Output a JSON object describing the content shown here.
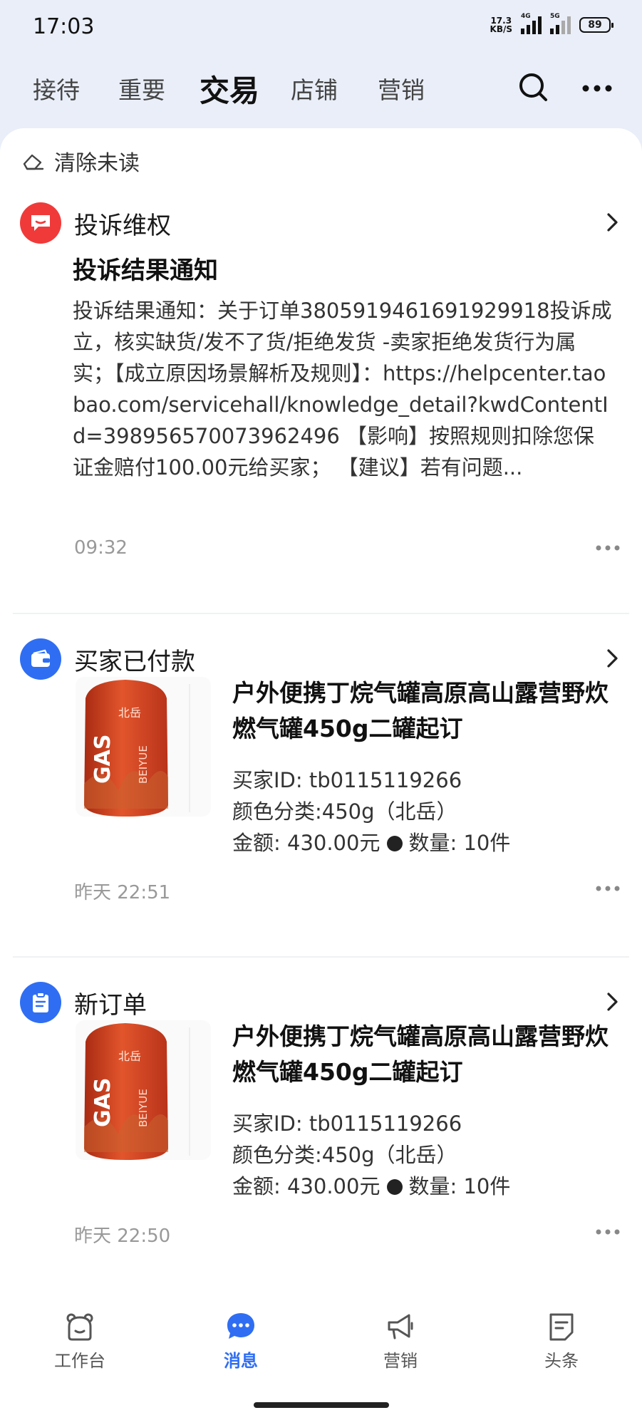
{
  "status_bar": {
    "time": "17:03",
    "net_speed_value": "17.3",
    "net_speed_unit": "KB/S",
    "signal1_label": "4G",
    "signal2_label": "5G",
    "battery": "89"
  },
  "top_tabs": [
    "接待",
    "重要",
    "交易",
    "店铺",
    "营销"
  ],
  "active_tab": "交易",
  "clear_unread_label": "清除未读",
  "cards": [
    {
      "type": "complaint",
      "icon": "complaint-icon",
      "category": "投诉维权",
      "title": "投诉结果通知",
      "body": "投诉结果通知：关于订单3805919461691929918投诉成立，核实缺货/发不了货/拒绝发货 -卖家拒绝发货行为属实；【成立原因场景解析及规则】：https://helpcenter.taobao.com/servicehall/knowledge_detail?kwdContentId=398956570073962496 【影响】按照规则扣除您保证金赔付100.00元给买家； 【建议】若有问题...",
      "time": "09:32"
    },
    {
      "type": "paid",
      "icon": "wallet-icon",
      "category": "买家已付款",
      "product_title": "户外便携丁烷气罐高原高山露营野炊燃气罐450g二罐起订",
      "buyer_id": "买家ID: tb0115119266",
      "variant": "颜色分类:450g（北岳）",
      "amount": "金额: 430.00元",
      "quantity": "数量: 10件",
      "time": "昨天 22:51"
    },
    {
      "type": "new_order",
      "icon": "order-icon",
      "category": "新订单",
      "product_title": "户外便携丁烷气罐高原高山露营野炊燃气罐450g二罐起订",
      "buyer_id": "买家ID: tb0115119266",
      "variant": "颜色分类:450g（北岳）",
      "amount": "金额: 430.00元",
      "quantity": "数量: 10件",
      "time": "昨天 22:50"
    }
  ],
  "product_image_text": {
    "gas": "GAS",
    "brand": "北岳",
    "brand_en": "BEIYUE"
  },
  "bottom_nav": [
    {
      "label": "工作台",
      "icon": "bear-icon"
    },
    {
      "label": "消息",
      "icon": "message-icon"
    },
    {
      "label": "营销",
      "icon": "megaphone-icon"
    },
    {
      "label": "头条",
      "icon": "news-icon"
    }
  ],
  "active_bottom": "消息",
  "colors": {
    "accent": "#2f6ef3",
    "complaint_red": "#f03a3a",
    "page_bg": "#e9eef8",
    "gas_can": "#d9441f"
  }
}
